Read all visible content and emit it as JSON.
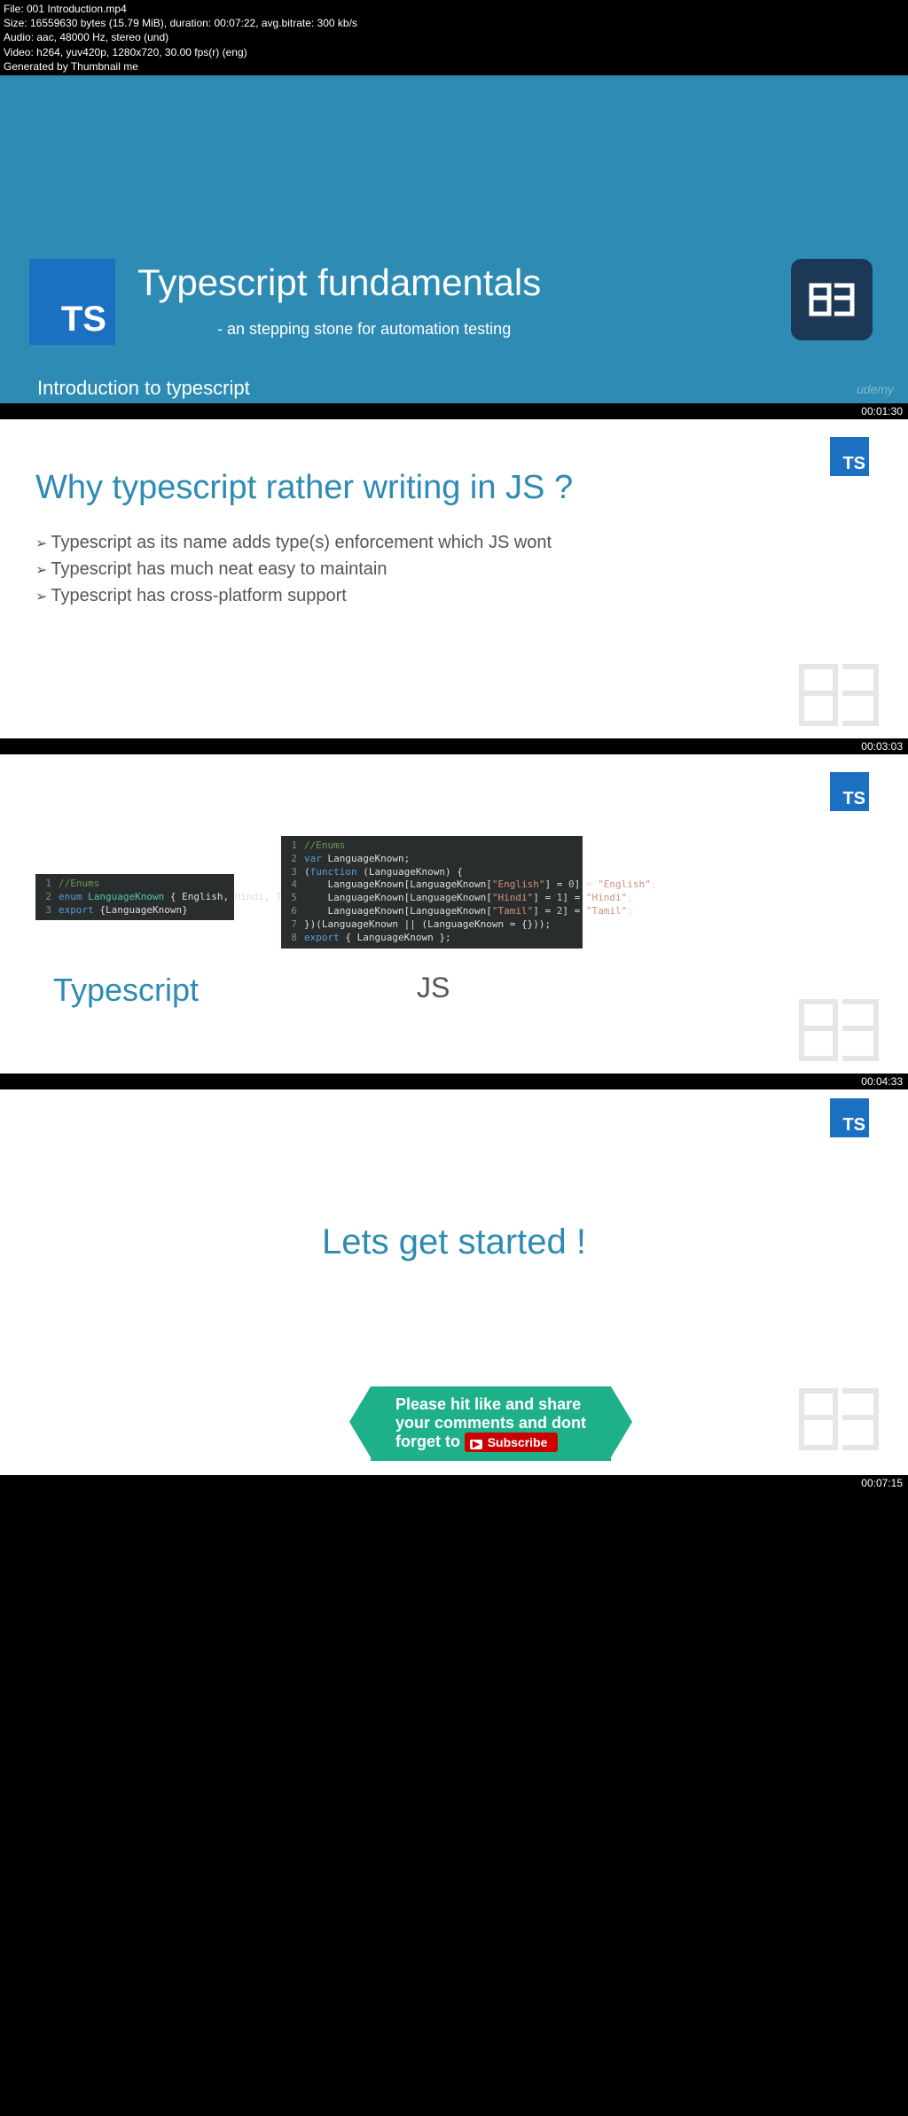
{
  "meta": {
    "line1": "File: 001 Introduction.mp4",
    "line2": "Size: 16559630 bytes (15.79 MiB), duration: 00:07:22, avg.bitrate: 300 kb/s",
    "line3": "Audio: aac, 48000 Hz, stereo (und)",
    "line4": "Video: h264, yuv420p, 1280x720, 30.00 fps(r) (eng)",
    "line5": "Generated by Thumbnail me"
  },
  "slide1": {
    "ts_logo": "TS",
    "title": "Typescript fundamentals",
    "subtitle": "- an stepping stone for automation testing",
    "intro": "Introduction to typescript",
    "udemy": "udemy",
    "timestamp": "00:01:30"
  },
  "slide2": {
    "ts_logo": "TS",
    "heading": "Why typescript rather writing in JS ?",
    "bullets": [
      "Typescript as its name adds type(s) enforcement which JS wont",
      "Typescript has much neat easy to maintain",
      "Typescript has cross-platform support"
    ],
    "timestamp": "00:03:03"
  },
  "slide3": {
    "ts_logo": "TS",
    "label_ts": "Typescript",
    "label_js": "JS",
    "code_ts": {
      "l1_comment": "//Enums",
      "l2": {
        "kw": "enum",
        "type": "LanguageKnown",
        "body": " { English, Hindi, Tamil}"
      },
      "l3": {
        "kw": "export",
        "body": " {LanguageKnown}"
      }
    },
    "code_js": {
      "l1_comment": "//Enums",
      "l2": {
        "kw": "var",
        "body": " LanguageKnown;"
      },
      "l3": {
        "prefix": "(",
        "kw": "function",
        "body": " (LanguageKnown) {"
      },
      "l4": {
        "pad": "    LanguageKnown[LanguageKnown[",
        "s1": "\"English\"",
        "mid": "] = ",
        "n1": "0",
        "rest": "] = ",
        "s2": "\"English\"",
        "end": ";"
      },
      "l5": {
        "pad": "    LanguageKnown[LanguageKnown[",
        "s1": "\"Hindi\"",
        "mid": "] = ",
        "n1": "1",
        "rest": "] = ",
        "s2": "\"Hindi\"",
        "end": ";"
      },
      "l6": {
        "pad": "    LanguageKnown[LanguageKnown[",
        "s1": "\"Tamil\"",
        "mid": "] = ",
        "n1": "2",
        "rest": "] = ",
        "s2": "\"Tamil\"",
        "end": ";"
      },
      "l7": "})(LanguageKnown || (LanguageKnown = {}));",
      "l8": {
        "kw": "export",
        "body": " { LanguageKnown };"
      }
    },
    "timestamp": "00:04:33"
  },
  "slide4": {
    "ts_logo": "TS",
    "heading": "Lets get started !",
    "banner_l1": "Please hit like and share",
    "banner_l2": "your comments and dont",
    "banner_l3_pre": "forget to ",
    "subscribe": "Subscribe",
    "timestamp": "00:07:15"
  }
}
